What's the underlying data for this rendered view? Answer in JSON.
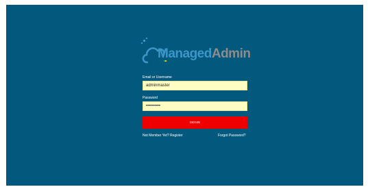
{
  "app": {
    "logo_part1": "Managed",
    "logo_part2": "Admin",
    "brand_color": "#3c97c8",
    "background_color": "#03597d",
    "icon": "cloud-logo-icon"
  },
  "login": {
    "email_label": "Email or Username",
    "email_value": "adminmaster",
    "password_label": "Password",
    "password_value": "••••••••••",
    "signin_label": "SIGNIN",
    "signin_color": "#ee0000",
    "register_link": "Not Member Yet? Register",
    "forgot_link": "Forgot Password?"
  }
}
